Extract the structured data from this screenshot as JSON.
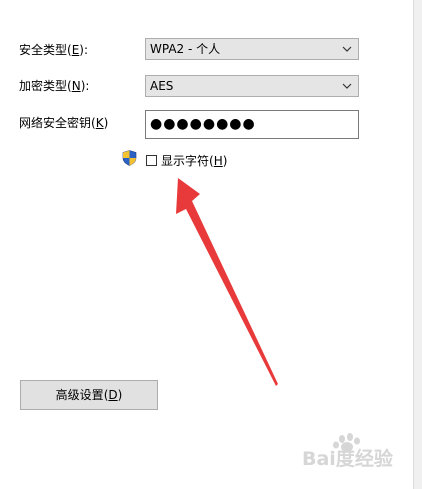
{
  "form": {
    "security_type": {
      "label": "安全类型",
      "mnemonic": "E",
      "value": "WPA2 - 个人"
    },
    "encryption_type": {
      "label": "加密类型",
      "mnemonic": "N",
      "value": "AES"
    },
    "network_key": {
      "label": "网络安全密钥",
      "mnemonic": "K",
      "value": "●●●●●●●●"
    },
    "show_chars": {
      "label": "显示字符",
      "mnemonic": "H",
      "checked": false
    },
    "advanced_button": {
      "label": "高级设置",
      "mnemonic": "D"
    }
  },
  "watermark": {
    "text": "Bai度经验"
  },
  "colors": {
    "arrow": "#e83a3a",
    "combo_bg": "#e5e5e5",
    "button_bg": "#e1e1e1"
  },
  "icons": {
    "shield": "uac-shield-icon",
    "dropdown": "chevron-down-icon"
  }
}
